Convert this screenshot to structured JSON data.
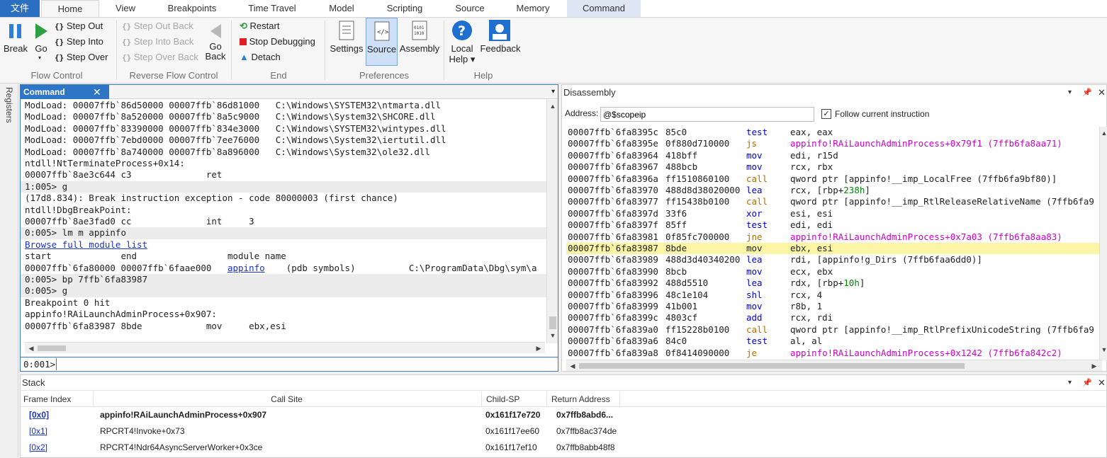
{
  "tabs": [
    {
      "label": "文件"
    },
    {
      "label": "Home"
    },
    {
      "label": "View"
    },
    {
      "label": "Breakpoints"
    },
    {
      "label": "Time Travel"
    },
    {
      "label": "Model"
    },
    {
      "label": "Scripting"
    },
    {
      "label": "Source"
    },
    {
      "label": "Memory"
    },
    {
      "label": "Command"
    }
  ],
  "ribbon": {
    "flow": {
      "break": "Break",
      "go": "Go",
      "step_out": "Step Out",
      "step_into": "Step Into",
      "step_over": "Step Over",
      "group": "Flow Control"
    },
    "reverse": {
      "step_out_back": "Step Out Back",
      "step_into_back": "Step Into Back",
      "step_over_back": "Step Over Back",
      "go_back_1": "Go",
      "go_back_2": "Back",
      "group": "Reverse Flow Control"
    },
    "end": {
      "restart": "Restart",
      "stop": "Stop Debugging",
      "detach": "Detach",
      "group": "End"
    },
    "prefs": {
      "settings": "Settings",
      "source": "Source",
      "assembly": "Assembly",
      "group": "Preferences"
    },
    "help": {
      "local_help_1": "Local",
      "local_help_2": "Help",
      "feedback": "Feedback",
      "group": "Help"
    }
  },
  "side": {
    "registers": "Registers"
  },
  "command": {
    "title": "Command",
    "lines": [
      "ModLoad: 00007ffb`86d50000 00007ffb`86d81000   C:\\Windows\\SYSTEM32\\ntmarta.dll",
      "ModLoad: 00007ffb`8a520000 00007ffb`8a5c9000   C:\\Windows\\System32\\SHCORE.dll",
      "ModLoad: 00007ffb`83390000 00007ffb`834e3000   C:\\Windows\\SYSTEM32\\wintypes.dll",
      "ModLoad: 00007ffb`7ebd0000 00007ffb`7ee76000   C:\\Windows\\System32\\iertutil.dll",
      "ModLoad: 00007ffb`8a740000 00007ffb`8a896000   C:\\Windows\\System32\\ole32.dll",
      "ntdll!NtTerminateProcess+0x14:",
      "00007ffb`8ae3c644 c3              ret",
      "1:005> g",
      "(17d8.834): Break instruction exception - code 80000003 (first chance)",
      "ntdll!DbgBreakPoint:",
      "00007ffb`8ae3fad0 cc              int     3",
      "0:005> lm m appinfo",
      "",
      "start             end                 module name",
      "00007ffb`6fa80000 00007ffb`6faae000   ",
      "0:005> bp 7ffb`6fa83987",
      "0:005> g",
      "Breakpoint 0 hit",
      "appinfo!RAiLaunchAdminProcess+0x907:",
      "00007ffb`6fa83987 8bde            mov     ebx,esi"
    ],
    "browse_link": "Browse full module list",
    "appinfo_link": "appinfo",
    "appinfo_rest": "    (pdb symbols)          C:\\ProgramData\\Dbg\\sym\\a",
    "prompt": "0:001>",
    "input_value": ""
  },
  "disassembly": {
    "title": "Disassembly",
    "address_label": "Address:",
    "address_value": "@$scopeip",
    "follow_label": "Follow current instruction",
    "rows": [
      {
        "addr": "00007ffb`6fa8395c",
        "bytes": "85c0",
        "mn": "test",
        "ops": "eax, eax",
        "kind": "blue"
      },
      {
        "addr": "00007ffb`6fa8395e",
        "bytes": "0f880d710000",
        "mn": "js",
        "ops": "appinfo!RAiLaunchAdminProcess+0x79f1 (7ffb6fa8aa71)",
        "kind": "jump"
      },
      {
        "addr": "00007ffb`6fa83964",
        "bytes": "418bff",
        "mn": "mov",
        "ops": "edi, r15d",
        "kind": "blue"
      },
      {
        "addr": "00007ffb`6fa83967",
        "bytes": "488bcb",
        "mn": "mov",
        "ops": "rcx, rbx",
        "kind": "blue"
      },
      {
        "addr": "00007ffb`6fa8396a",
        "bytes": "ff1510860100",
        "mn": "call",
        "ops": "qword ptr [appinfo!__imp_LocalFree (7ffb6fa9bf80)]",
        "kind": "call"
      },
      {
        "addr": "00007ffb`6fa83970",
        "bytes": "488d8d38020000",
        "mn": "lea",
        "ops": "rcx, [rbp+238h]",
        "kind": "blue"
      },
      {
        "addr": "00007ffb`6fa83977",
        "bytes": "ff15438b0100",
        "mn": "call",
        "ops": "qword ptr [appinfo!__imp_RtlReleaseRelativeName (7ffb6fa9",
        "kind": "call"
      },
      {
        "addr": "00007ffb`6fa8397d",
        "bytes": "33f6",
        "mn": "xor",
        "ops": "esi, esi",
        "kind": "blue"
      },
      {
        "addr": "00007ffb`6fa8397f",
        "bytes": "85ff",
        "mn": "test",
        "ops": "edi, edi",
        "kind": "blue"
      },
      {
        "addr": "00007ffb`6fa83981",
        "bytes": "0f85fc700000",
        "mn": "jne",
        "ops": "appinfo!RAiLaunchAdminProcess+0x7a03 (7ffb6fa8aa83)",
        "kind": "jump"
      },
      {
        "addr": "00007ffb`6fa83987",
        "bytes": "8bde",
        "mn": "mov",
        "ops": "ebx, esi",
        "kind": "current"
      },
      {
        "addr": "00007ffb`6fa83989",
        "bytes": "488d3d40340200",
        "mn": "lea",
        "ops": "rdi, [appinfo!g_Dirs (7ffb6faa6dd0)]",
        "kind": "blue"
      },
      {
        "addr": "00007ffb`6fa83990",
        "bytes": "8bcb",
        "mn": "mov",
        "ops": "ecx, ebx",
        "kind": "blue"
      },
      {
        "addr": "00007ffb`6fa83992",
        "bytes": "488d5510",
        "mn": "lea",
        "ops": "rdx, [rbp+10h]",
        "kind": "blue"
      },
      {
        "addr": "00007ffb`6fa83996",
        "bytes": "48c1e104",
        "mn": "shl",
        "ops": "rcx, 4",
        "kind": "blue"
      },
      {
        "addr": "00007ffb`6fa83999",
        "bytes": "41b001",
        "mn": "mov",
        "ops": "r8b, 1",
        "kind": "blue"
      },
      {
        "addr": "00007ffb`6fa8399c",
        "bytes": "4803cf",
        "mn": "add",
        "ops": "rcx, rdi",
        "kind": "blue"
      },
      {
        "addr": "00007ffb`6fa839a0",
        "bytes": "ff15228b0100",
        "mn": "call",
        "ops": "qword ptr [appinfo!__imp_RtlPrefixUnicodeString (7ffb6fa9",
        "kind": "call"
      },
      {
        "addr": "00007ffb`6fa839a6",
        "bytes": "84c0",
        "mn": "test",
        "ops": "al, al",
        "kind": "blue"
      },
      {
        "addr": "00007ffb`6fa839a8",
        "bytes": "0f8414090000",
        "mn": "je",
        "ops": "appinfo!RAiLaunchAdminProcess+0x1242 (7ffb6fa842c2)",
        "kind": "jump"
      }
    ]
  },
  "stack": {
    "title": "Stack",
    "headers": {
      "frame": "Frame Index",
      "callsite": "Call Site",
      "childsp": "Child-SP",
      "ret": "Return Address"
    },
    "rows": [
      {
        "frame": "[0x0]",
        "callsite": "appinfo!RAiLaunchAdminProcess+0x907",
        "childsp": "0x161f17e720",
        "ret": "0x7ffb8abd6...",
        "bold": true
      },
      {
        "frame": "[0x1]",
        "callsite": "RPCRT4!Invoke+0x73",
        "childsp": "0x161f17ee60",
        "ret": "0x7ffb8ac374de",
        "bold": false
      },
      {
        "frame": "[0x2]",
        "callsite": "RPCRT4!Ndr64AsyncServerWorker+0x3ce",
        "childsp": "0x161f17ef10",
        "ret": "0x7ffb8abb48f8",
        "bold": false
      }
    ]
  },
  "colors": {
    "accent": "#2b6fc0",
    "current_line": "#fbf5a5",
    "jump_symbol": "#cc00cc",
    "mnemonic": "#0000e0",
    "call": "#b07000"
  }
}
